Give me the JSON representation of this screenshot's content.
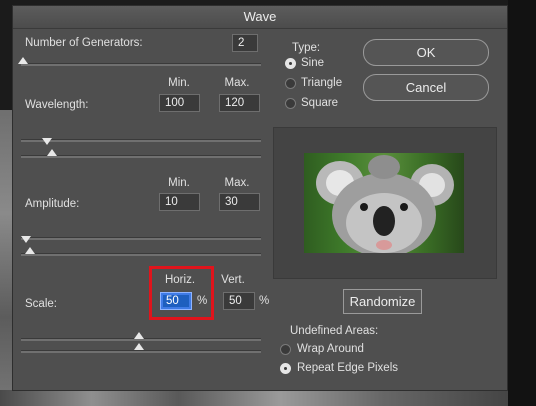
{
  "dialog": {
    "title": "Wave",
    "generators": {
      "label": "Number of Generators:",
      "value": "2",
      "slider_level": 0.01
    },
    "wavelength": {
      "label": "Wavelength:",
      "min_header": "Min.",
      "max_header": "Max.",
      "min_value": "100",
      "max_value": "120"
    },
    "amplitude": {
      "label": "Amplitude:",
      "min_header": "Min.",
      "max_header": "Max.",
      "min_value": "10",
      "max_value": "30"
    },
    "scale": {
      "label": "Scale:",
      "horiz_header": "Horiz.",
      "vert_header": "Vert.",
      "horiz_value": "50",
      "vert_value": "50",
      "unit": "%"
    },
    "type": {
      "label": "Type:",
      "options": [
        "Sine",
        "Triangle",
        "Square"
      ],
      "selected": "Sine"
    },
    "buttons": {
      "ok": "OK",
      "cancel": "Cancel",
      "randomize": "Randomize"
    },
    "undefined_areas": {
      "label": "Undefined Areas:",
      "options": [
        "Wrap Around",
        "Repeat Edge Pixels"
      ],
      "selected": "Repeat Edge Pixels"
    }
  },
  "colors": {
    "dialog_bg": "#4f4f4f",
    "highlight": "#e0141c",
    "selection": "#1e5fbf"
  }
}
